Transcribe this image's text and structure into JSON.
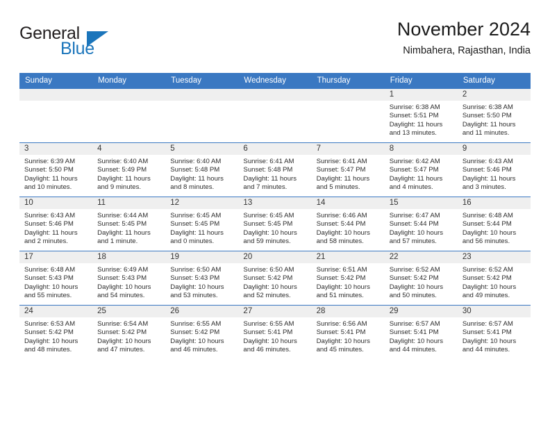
{
  "brand": {
    "name_part1": "General",
    "name_part2": "Blue",
    "icon": "triangle-logo-icon",
    "colors": {
      "dark": "#231f20",
      "blue": "#1b75bb"
    }
  },
  "header": {
    "title": "November 2024",
    "subtitle": "Nimbahera, Rajasthan, India"
  },
  "theme": {
    "header_bg": "#3a78c2",
    "day_strip_bg": "#efefef",
    "cell_bg": "#ffffff",
    "text": "#2b2b2b"
  },
  "calendar": {
    "weekday_headers": [
      "Sunday",
      "Monday",
      "Tuesday",
      "Wednesday",
      "Thursday",
      "Friday",
      "Saturday"
    ],
    "weeks": [
      [
        {
          "day": "",
          "blank": true,
          "sunrise": "",
          "sunset": "",
          "daylight_line1": "",
          "daylight_line2": ""
        },
        {
          "day": "",
          "blank": true,
          "sunrise": "",
          "sunset": "",
          "daylight_line1": "",
          "daylight_line2": ""
        },
        {
          "day": "",
          "blank": true,
          "sunrise": "",
          "sunset": "",
          "daylight_line1": "",
          "daylight_line2": ""
        },
        {
          "day": "",
          "blank": true,
          "sunrise": "",
          "sunset": "",
          "daylight_line1": "",
          "daylight_line2": ""
        },
        {
          "day": "",
          "blank": true,
          "sunrise": "",
          "sunset": "",
          "daylight_line1": "",
          "daylight_line2": ""
        },
        {
          "day": "1",
          "sunrise": "Sunrise: 6:38 AM",
          "sunset": "Sunset: 5:51 PM",
          "daylight_line1": "Daylight: 11 hours",
          "daylight_line2": "and 13 minutes."
        },
        {
          "day": "2",
          "sunrise": "Sunrise: 6:38 AM",
          "sunset": "Sunset: 5:50 PM",
          "daylight_line1": "Daylight: 11 hours",
          "daylight_line2": "and 11 minutes."
        }
      ],
      [
        {
          "day": "3",
          "sunrise": "Sunrise: 6:39 AM",
          "sunset": "Sunset: 5:50 PM",
          "daylight_line1": "Daylight: 11 hours",
          "daylight_line2": "and 10 minutes."
        },
        {
          "day": "4",
          "sunrise": "Sunrise: 6:40 AM",
          "sunset": "Sunset: 5:49 PM",
          "daylight_line1": "Daylight: 11 hours",
          "daylight_line2": "and 9 minutes."
        },
        {
          "day": "5",
          "sunrise": "Sunrise: 6:40 AM",
          "sunset": "Sunset: 5:48 PM",
          "daylight_line1": "Daylight: 11 hours",
          "daylight_line2": "and 8 minutes."
        },
        {
          "day": "6",
          "sunrise": "Sunrise: 6:41 AM",
          "sunset": "Sunset: 5:48 PM",
          "daylight_line1": "Daylight: 11 hours",
          "daylight_line2": "and 7 minutes."
        },
        {
          "day": "7",
          "sunrise": "Sunrise: 6:41 AM",
          "sunset": "Sunset: 5:47 PM",
          "daylight_line1": "Daylight: 11 hours",
          "daylight_line2": "and 5 minutes."
        },
        {
          "day": "8",
          "sunrise": "Sunrise: 6:42 AM",
          "sunset": "Sunset: 5:47 PM",
          "daylight_line1": "Daylight: 11 hours",
          "daylight_line2": "and 4 minutes."
        },
        {
          "day": "9",
          "sunrise": "Sunrise: 6:43 AM",
          "sunset": "Sunset: 5:46 PM",
          "daylight_line1": "Daylight: 11 hours",
          "daylight_line2": "and 3 minutes."
        }
      ],
      [
        {
          "day": "10",
          "sunrise": "Sunrise: 6:43 AM",
          "sunset": "Sunset: 5:46 PM",
          "daylight_line1": "Daylight: 11 hours",
          "daylight_line2": "and 2 minutes."
        },
        {
          "day": "11",
          "sunrise": "Sunrise: 6:44 AM",
          "sunset": "Sunset: 5:45 PM",
          "daylight_line1": "Daylight: 11 hours",
          "daylight_line2": "and 1 minute."
        },
        {
          "day": "12",
          "sunrise": "Sunrise: 6:45 AM",
          "sunset": "Sunset: 5:45 PM",
          "daylight_line1": "Daylight: 11 hours",
          "daylight_line2": "and 0 minutes."
        },
        {
          "day": "13",
          "sunrise": "Sunrise: 6:45 AM",
          "sunset": "Sunset: 5:45 PM",
          "daylight_line1": "Daylight: 10 hours",
          "daylight_line2": "and 59 minutes."
        },
        {
          "day": "14",
          "sunrise": "Sunrise: 6:46 AM",
          "sunset": "Sunset: 5:44 PM",
          "daylight_line1": "Daylight: 10 hours",
          "daylight_line2": "and 58 minutes."
        },
        {
          "day": "15",
          "sunrise": "Sunrise: 6:47 AM",
          "sunset": "Sunset: 5:44 PM",
          "daylight_line1": "Daylight: 10 hours",
          "daylight_line2": "and 57 minutes."
        },
        {
          "day": "16",
          "sunrise": "Sunrise: 6:48 AM",
          "sunset": "Sunset: 5:44 PM",
          "daylight_line1": "Daylight: 10 hours",
          "daylight_line2": "and 56 minutes."
        }
      ],
      [
        {
          "day": "17",
          "sunrise": "Sunrise: 6:48 AM",
          "sunset": "Sunset: 5:43 PM",
          "daylight_line1": "Daylight: 10 hours",
          "daylight_line2": "and 55 minutes."
        },
        {
          "day": "18",
          "sunrise": "Sunrise: 6:49 AM",
          "sunset": "Sunset: 5:43 PM",
          "daylight_line1": "Daylight: 10 hours",
          "daylight_line2": "and 54 minutes."
        },
        {
          "day": "19",
          "sunrise": "Sunrise: 6:50 AM",
          "sunset": "Sunset: 5:43 PM",
          "daylight_line1": "Daylight: 10 hours",
          "daylight_line2": "and 53 minutes."
        },
        {
          "day": "20",
          "sunrise": "Sunrise: 6:50 AM",
          "sunset": "Sunset: 5:42 PM",
          "daylight_line1": "Daylight: 10 hours",
          "daylight_line2": "and 52 minutes."
        },
        {
          "day": "21",
          "sunrise": "Sunrise: 6:51 AM",
          "sunset": "Sunset: 5:42 PM",
          "daylight_line1": "Daylight: 10 hours",
          "daylight_line2": "and 51 minutes."
        },
        {
          "day": "22",
          "sunrise": "Sunrise: 6:52 AM",
          "sunset": "Sunset: 5:42 PM",
          "daylight_line1": "Daylight: 10 hours",
          "daylight_line2": "and 50 minutes."
        },
        {
          "day": "23",
          "sunrise": "Sunrise: 6:52 AM",
          "sunset": "Sunset: 5:42 PM",
          "daylight_line1": "Daylight: 10 hours",
          "daylight_line2": "and 49 minutes."
        }
      ],
      [
        {
          "day": "24",
          "sunrise": "Sunrise: 6:53 AM",
          "sunset": "Sunset: 5:42 PM",
          "daylight_line1": "Daylight: 10 hours",
          "daylight_line2": "and 48 minutes."
        },
        {
          "day": "25",
          "sunrise": "Sunrise: 6:54 AM",
          "sunset": "Sunset: 5:42 PM",
          "daylight_line1": "Daylight: 10 hours",
          "daylight_line2": "and 47 minutes."
        },
        {
          "day": "26",
          "sunrise": "Sunrise: 6:55 AM",
          "sunset": "Sunset: 5:42 PM",
          "daylight_line1": "Daylight: 10 hours",
          "daylight_line2": "and 46 minutes."
        },
        {
          "day": "27",
          "sunrise": "Sunrise: 6:55 AM",
          "sunset": "Sunset: 5:41 PM",
          "daylight_line1": "Daylight: 10 hours",
          "daylight_line2": "and 46 minutes."
        },
        {
          "day": "28",
          "sunrise": "Sunrise: 6:56 AM",
          "sunset": "Sunset: 5:41 PM",
          "daylight_line1": "Daylight: 10 hours",
          "daylight_line2": "and 45 minutes."
        },
        {
          "day": "29",
          "sunrise": "Sunrise: 6:57 AM",
          "sunset": "Sunset: 5:41 PM",
          "daylight_line1": "Daylight: 10 hours",
          "daylight_line2": "and 44 minutes."
        },
        {
          "day": "30",
          "sunrise": "Sunrise: 6:57 AM",
          "sunset": "Sunset: 5:41 PM",
          "daylight_line1": "Daylight: 10 hours",
          "daylight_line2": "and 44 minutes."
        }
      ]
    ]
  }
}
